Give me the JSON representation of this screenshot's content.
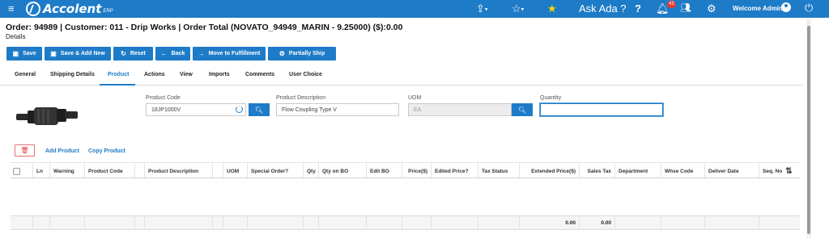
{
  "topbar": {
    "logo_text": "Accolent",
    "logo_sub": "ERP",
    "ask_ada": "Ask Ada ?",
    "notification_count": "43",
    "welcome": "Welcome Admin",
    "icons": [
      "hamburger-icon",
      "share-icon",
      "star-outline-icon",
      "star-filled-icon",
      "help-icon",
      "bell-icon",
      "users-icon",
      "gear-icon",
      "user-icon",
      "power-icon"
    ],
    "bg_color": "#1e7bc7"
  },
  "header": {
    "title": "Order: 94989 | Customer: 011 - Drip Works | Order Total (NOVATO_94949_MARIN - 9.25000) ($):0.00",
    "subtitle": "Details"
  },
  "actions": [
    {
      "label": "Save",
      "icon": "save-icon",
      "glyph": "💾"
    },
    {
      "label": "Save & Add New",
      "icon": "save-icon",
      "glyph": "💾"
    },
    {
      "label": "Reset",
      "icon": "reset-icon",
      "glyph": "↻"
    },
    {
      "label": "Back",
      "icon": "arrow-left-icon",
      "glyph": "←"
    },
    {
      "label": "Move to Fulfillment",
      "icon": "arrow-right-icon",
      "glyph": "→"
    },
    {
      "label": "Partially Ship",
      "icon": "gear-icon",
      "glyph": "⚙"
    }
  ],
  "tabs": [
    "General",
    "Shipping Details",
    "Product",
    "Actions",
    "View",
    "Imports",
    "Comments",
    "User Choice"
  ],
  "active_tab": "Product",
  "form": {
    "product_code_label": "Product Code",
    "product_code_value": "18JP1000V",
    "product_desc_label": "Product Description",
    "product_desc_value": "Flow Coupling Type V",
    "uom_label": "UOM",
    "uom_value": "EA",
    "quantity_label": "Quantity",
    "quantity_value": ""
  },
  "line_actions": {
    "add_product": "Add Product",
    "copy_product": "Copy Product"
  },
  "grid": {
    "columns": [
      "Ln",
      "Warning",
      "Product Code",
      "Product Description",
      "UOM",
      "Special Order?",
      "Qty",
      "Qty on BO",
      "Edit BO",
      "Price($)",
      "Edited Price?",
      "Tax Status",
      "Extended Price($)",
      "Sales Tax",
      "Department",
      "Whse Code",
      "Deliver Date",
      "Seq. No"
    ],
    "footer": {
      "extended_price_total": "0.00",
      "sales_tax_total": "0.00"
    }
  }
}
